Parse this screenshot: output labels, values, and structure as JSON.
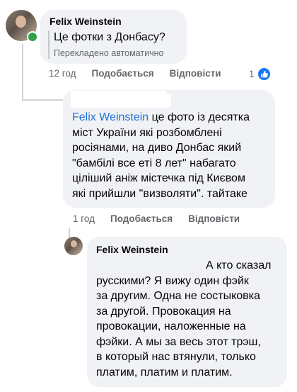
{
  "comments": [
    {
      "author": "Felix Weinstein",
      "text": "Це фотки з Донбасу?",
      "translated_note": "Перекладено автоматично",
      "time": "12 год",
      "like_label": "Подобається",
      "reply_label": "Відповісти",
      "reaction_count": "1",
      "reaction_icon": "like-icon"
    },
    {
      "author": "",
      "mention": "Felix Weinstein",
      "text_lines": [
        " це фото із десятка",
        "міст України які розбомблені",
        "росіянами, на диво Донбас який",
        "\"бамбілі все еті 8 лет\" набагато",
        "ціліший аніж містечка під Києвом",
        "які прийшли \"визволяти\". тайтаке"
      ],
      "time": "1 год",
      "like_label": "Подобається",
      "reply_label": "Відповісти"
    },
    {
      "author": "Felix Weinstein",
      "text_lines": [
        "А кто сказал",
        "русскими? Я вижу один фэйк",
        "за другим. Одна не состыковка",
        "за другой. Провокация на",
        "провокации, наложенные на",
        "фэйки. А мы за весь этот трэш,",
        "в который нас втянули, только",
        "платим, платим и платим."
      ]
    }
  ],
  "colors": {
    "bubble": "#f0f2f5",
    "mention": "#216fdb",
    "meta": "#65676b",
    "online": "#31a24c",
    "like_badge": "#1877f2"
  }
}
